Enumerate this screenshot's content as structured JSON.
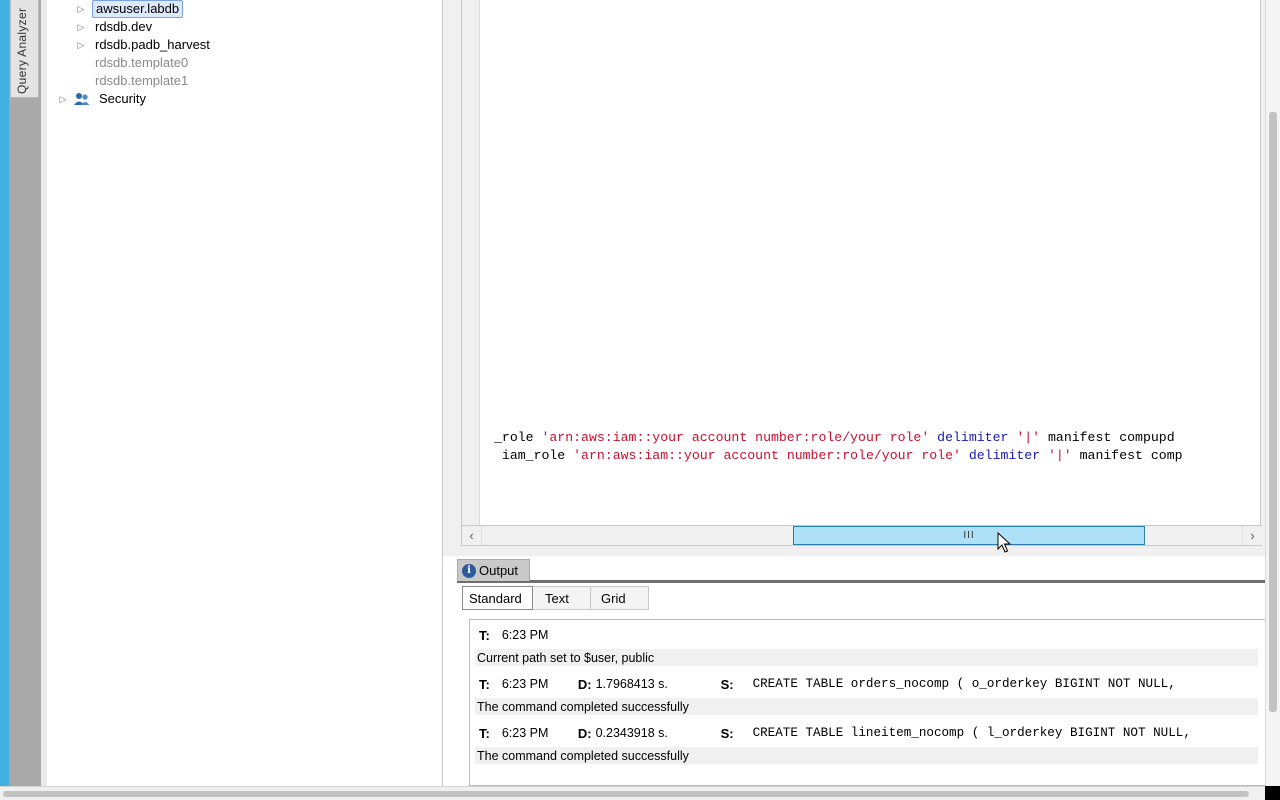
{
  "side_tab": {
    "label": "Query Analyzer"
  },
  "tree": {
    "items": [
      {
        "label": "awsuser.labdb",
        "state": "selected",
        "expandable": true
      },
      {
        "label": "rdsdb.dev",
        "state": "normal",
        "expandable": true
      },
      {
        "label": "rdsdb.padb_harvest",
        "state": "normal",
        "expandable": true
      },
      {
        "label": "rdsdb.template0",
        "state": "muted",
        "expandable": false
      },
      {
        "label": "rdsdb.template1",
        "state": "muted",
        "expandable": false
      }
    ],
    "security": {
      "label": "Security",
      "icon": "users-icon"
    }
  },
  "editor": {
    "line1": {
      "prefix": "_role ",
      "arn": "'arn:aws:iam::your account number:role/your role'",
      "kw": " delimiter ",
      "delim": "'|'",
      "suffix": " manifest compupd"
    },
    "line2": {
      "prefix": " iam_role ",
      "arn": "'arn:aws:iam::your account number:role/your role'",
      "kw": " delimiter ",
      "delim": "'|'",
      "suffix": " manifest comp"
    },
    "scroll_grip": "III"
  },
  "output": {
    "tab_label": "Output",
    "subtabs": [
      "Standard",
      "Text",
      "Grid"
    ],
    "labels": {
      "t": "T:",
      "d": "D:",
      "s": "S:"
    },
    "messages": [
      {
        "time": "6:23 PM",
        "duration": "",
        "statement": "",
        "result": "Current path set to $user, public"
      },
      {
        "time": "6:23 PM",
        "duration": "1.7968413 s.",
        "statement": "CREATE TABLE orders_nocomp (  o_orderkey BIGINT NOT NULL,",
        "result": "The command completed successfully"
      },
      {
        "time": "6:23 PM",
        "duration": "0.2343918 s.",
        "statement": "CREATE TABLE lineitem_nocomp (  l_orderkey BIGINT NOT NULL,",
        "result": "The command completed successfully"
      }
    ]
  },
  "colors": {
    "accent_strip": "#3fb0e0",
    "scroll_thumb": "#aee0f7",
    "string_literal": "#c8102e",
    "keyword": "#1a1ab5"
  }
}
